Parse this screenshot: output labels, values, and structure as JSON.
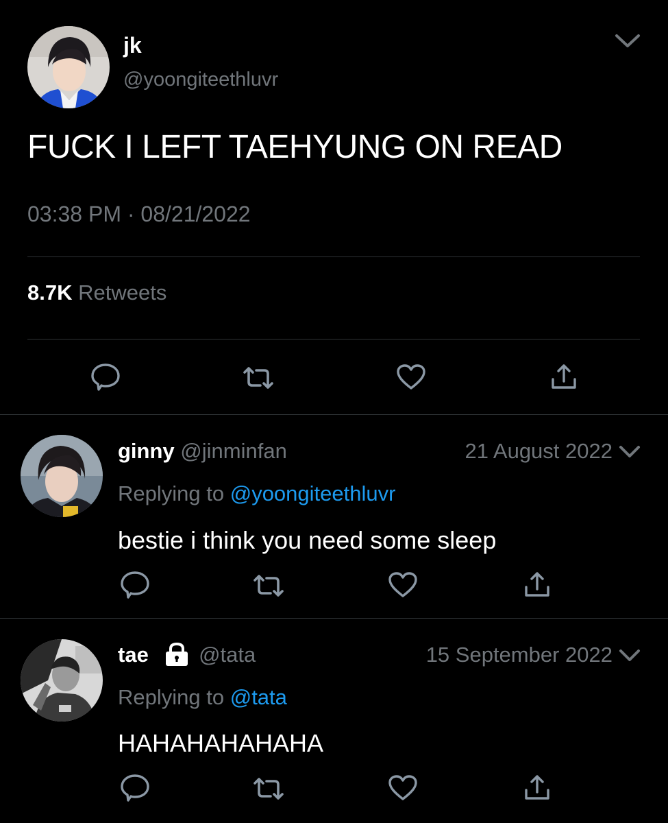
{
  "main_tweet": {
    "display_name": "jk",
    "handle": "@yoongiteethluvr",
    "text": "FUCK I LEFT TAEHYUNG ON READ",
    "time": "03:38 PM",
    "separator": "·",
    "date": "08/21/2022",
    "retweets_count": "8.7K",
    "retweets_label": "Retweets"
  },
  "replies": [
    {
      "display_name": "ginny",
      "handle": "@jinminfan",
      "date": "21 August 2022",
      "replying_prefix": "Replying to",
      "replying_to": "@yoongiteethluvr",
      "text": "bestie i think you need some sleep",
      "locked": false
    },
    {
      "display_name": "tae",
      "handle": "@tata",
      "date": "15 September 2022",
      "replying_prefix": "Replying to",
      "replying_to": "@tata",
      "text": "HAHAHAHAHAHA",
      "locked": true
    }
  ],
  "icons": {
    "reply": "reply-icon",
    "retweet": "retweet-icon",
    "like": "heart-icon",
    "share": "share-icon",
    "more": "chevron-down-icon",
    "lock": "lock-icon"
  },
  "colors": {
    "background": "#000000",
    "text": "#ffffff",
    "muted": "#71767b",
    "link": "#1d9bf0",
    "divider": "#2f3336"
  }
}
